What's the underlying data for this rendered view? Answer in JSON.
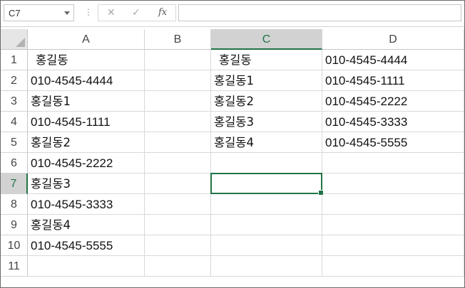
{
  "formula_bar": {
    "name_box": "C7",
    "dots": "⋮",
    "cancel": "✕",
    "enter": "✓",
    "fx": "fx",
    "content": ""
  },
  "accent_color": "#217346",
  "columns": [
    "A",
    "B",
    "C",
    "D"
  ],
  "rows": [
    "1",
    "2",
    "3",
    "4",
    "5",
    "6",
    "7",
    "8",
    "9",
    "10",
    "11"
  ],
  "cells": {
    "A1": " 홍길동",
    "A2": "010-4545-4444",
    "A3": "홍길동1",
    "A4": "010-4545-1111",
    "A5": "홍길동2",
    "A6": "010-4545-2222",
    "A7": "홍길동3",
    "A8": "010-4545-3333",
    "A9": "홍길동4",
    "A10": "010-4545-5555",
    "C1": " 홍길동",
    "C2": "홍길동1",
    "C3": "홍길동2",
    "C4": "홍길동3",
    "C5": "홍길동4",
    "D1": "010-4545-4444",
    "D2": "010-4545-1111",
    "D3": "010-4545-2222",
    "D4": "010-4545-3333",
    "D5": "010-4545-5555"
  },
  "selected_cell": "C7"
}
